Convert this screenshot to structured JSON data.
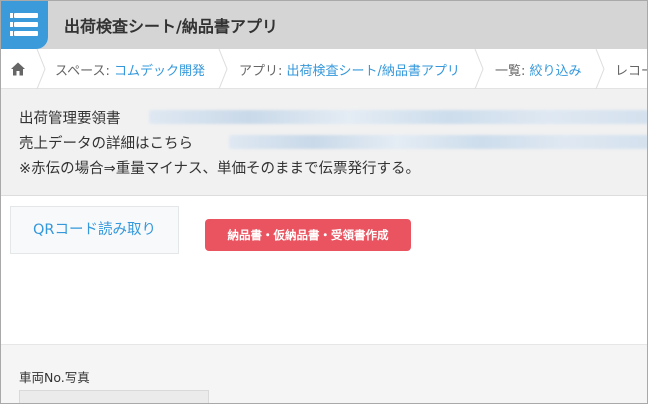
{
  "app": {
    "title": "出荷検査シート/納品書アプリ",
    "icon": "list-icon",
    "accent_color": "#3b9ad9"
  },
  "breadcrumb": {
    "home_icon": "home-icon",
    "space_prefix": "スペース: ",
    "space_link": "コムデック開発",
    "app_prefix": "アプリ: ",
    "app_link": "出荷検査シート/納品書アプリ",
    "view_prefix": "一覧: ",
    "view_link": "絞り込み",
    "record_label": "レコー"
  },
  "info": {
    "line1": "出荷管理要領書",
    "line2": "売上データの詳細はこちら",
    "line3": "※赤伝の場合⇒重量マイナス、単価そのままで伝票発行する。"
  },
  "actions": {
    "qr_label": "QRコード読み取り",
    "doc_label": "納品書・仮納品書・受領書作成",
    "doc_color": "#ea5461"
  },
  "record": {
    "field_label": "車両No.写真"
  }
}
